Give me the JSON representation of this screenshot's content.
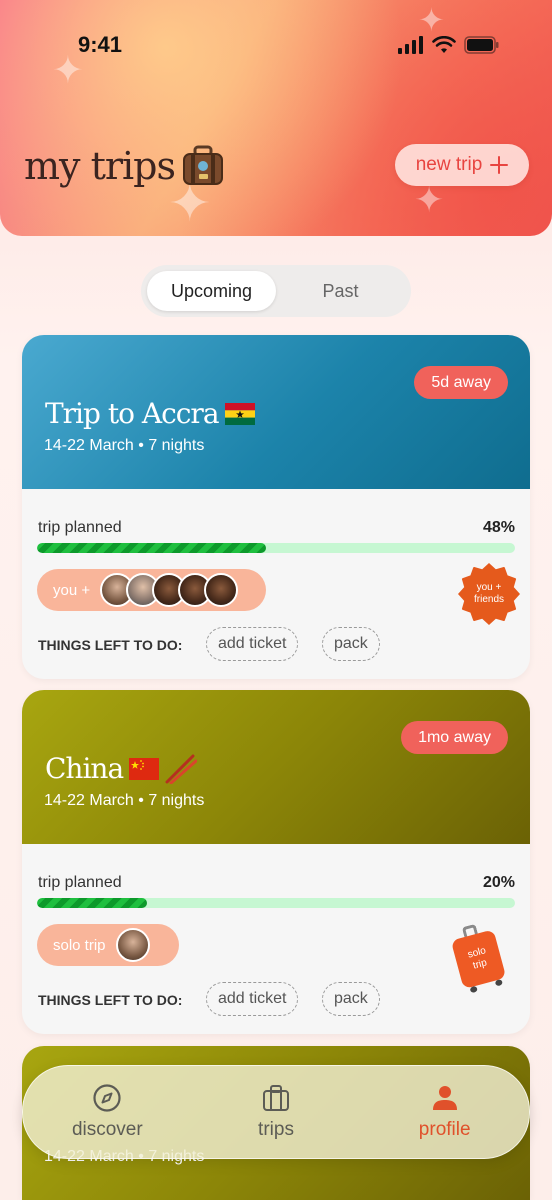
{
  "status": {
    "time": "9:41"
  },
  "header": {
    "title": "my trips",
    "title_icon": "suitcase-emoji",
    "new_trip_label": "new trip",
    "new_trip_icon": "plus-icon"
  },
  "segmented": {
    "tabs": [
      {
        "label": "Upcoming",
        "active": true
      },
      {
        "label": "Past",
        "active": false
      }
    ]
  },
  "trips": [
    {
      "title": "Trip to Accra",
      "flag": "🇬🇭",
      "dates": "14-22 March • 7 nights",
      "away": "5d away",
      "color_from": "#4aa9d0",
      "color_to": "#0f6d8f",
      "progress_label": "trip planned",
      "progress_text": "48%",
      "progress": 0.48,
      "companions_label": "you +",
      "avatar_count": 5,
      "todo_label": "THINGS LEFT TO DO:",
      "todos": [
        "add ticket",
        "pack"
      ],
      "sticker": "you + friends"
    },
    {
      "title": "China",
      "flag": "🇨🇳",
      "extra_emoji": "🥢",
      "dates": "14-22 March • 7 nights",
      "away": "1mo away",
      "color_from": "#a8a610",
      "color_to": "#6b6205",
      "progress_label": "trip planned",
      "progress_text": "20%",
      "progress": 0.2,
      "companions_label": "solo trip",
      "avatar_count": 1,
      "todo_label": "THINGS LEFT TO DO:",
      "todos": [
        "add ticket",
        "pack"
      ],
      "sticker": "solo trip"
    },
    {
      "dates": "14-22 March • 7 nights",
      "color_from": "#a8a610",
      "color_to": "#6b6205"
    }
  ],
  "nav": [
    {
      "label": "discover",
      "icon": "compass-icon",
      "active": false
    },
    {
      "label": "trips",
      "icon": "suitcase-icon",
      "active": false
    },
    {
      "label": "profile",
      "icon": "person-icon",
      "active": true
    }
  ],
  "colors": {
    "accent": "#f0625b",
    "progress": "#1fbf3f",
    "nav_active": "#e0512b"
  }
}
